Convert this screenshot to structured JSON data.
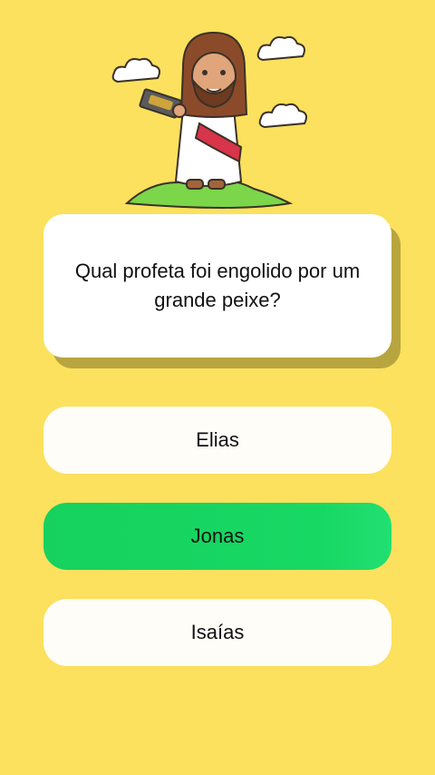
{
  "question": {
    "text": "Qual profeta foi engolido por um grande peixe?"
  },
  "answers": [
    {
      "label": "Elias",
      "state": "default"
    },
    {
      "label": "Jonas",
      "state": "correct"
    },
    {
      "label": "Isaías",
      "state": "default"
    }
  ],
  "colors": {
    "background": "#fbe15d",
    "card": "#ffffff",
    "correct": "#16d15e",
    "shadow": "#b8a53f",
    "text": "#111111"
  },
  "illustration": {
    "icon": "jesus-with-book-illustration"
  }
}
